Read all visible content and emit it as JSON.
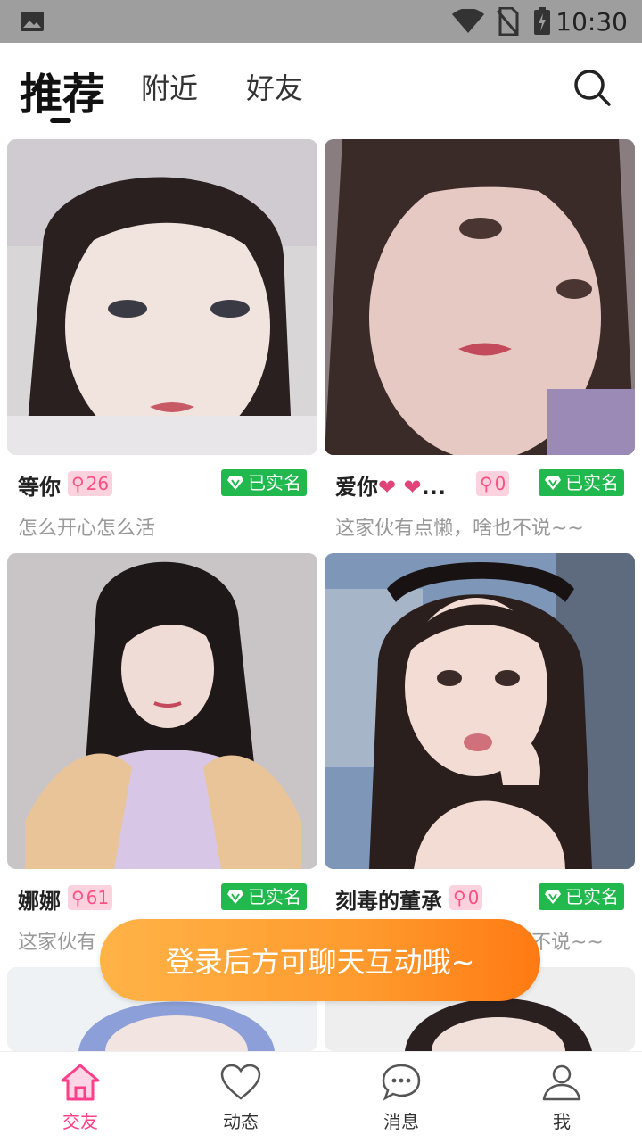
{
  "status_bar": {
    "time": "10:30",
    "icons": [
      "image-icon",
      "wifi-icon",
      "no-sim-icon",
      "battery-charging-icon"
    ]
  },
  "top_tabs": [
    {
      "label": "推荐",
      "active": true
    },
    {
      "label": "附近",
      "active": false
    },
    {
      "label": "好友",
      "active": false
    }
  ],
  "cards": [
    {
      "name": "等你",
      "count": "26",
      "verified": "已实名",
      "bio": "怎么开心怎么活",
      "hearts": false
    },
    {
      "name": "爱你",
      "count": "0",
      "verified": "已实名",
      "bio": "这家伙有点懒，啥也不说~~",
      "hearts": true,
      "ellipsis": "..."
    },
    {
      "name": "娜娜",
      "count": "61",
      "verified": "已实名",
      "bio": "这家伙有",
      "hearts": false
    },
    {
      "name": "刻毒的董承",
      "count": "0",
      "verified": "已实名",
      "bio": "不说~~",
      "hearts": false
    }
  ],
  "toast": "登录后方可聊天互动哦~",
  "bottom_nav": [
    {
      "label": "交友",
      "icon": "home-icon",
      "active": true
    },
    {
      "label": "动态",
      "icon": "heart-icon",
      "active": false
    },
    {
      "label": "消息",
      "icon": "chat-bubble-icon",
      "active": false
    },
    {
      "label": "我",
      "icon": "person-icon",
      "active": false
    }
  ],
  "colors": {
    "accent": "#ff3f8a",
    "verified": "#21b94e",
    "toast": "#ff9a2e",
    "badge_bg": "#fbd2dd"
  }
}
